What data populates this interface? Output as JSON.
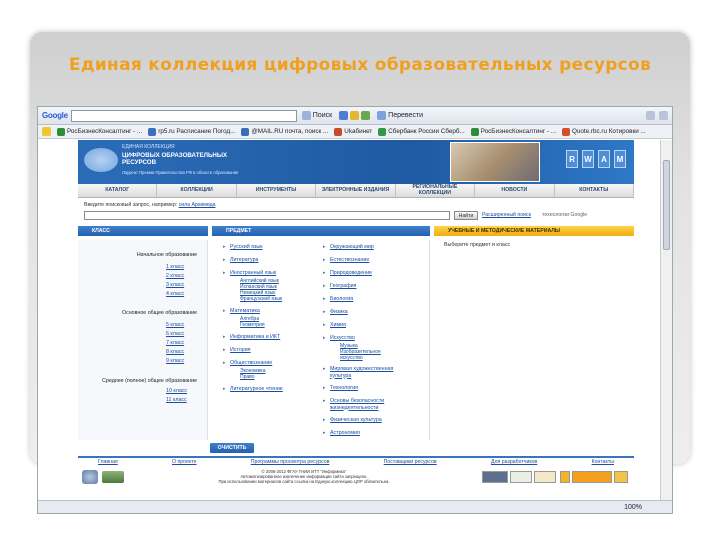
{
  "slide": {
    "title": "Единая коллекция цифровых образовательных ресурсов"
  },
  "browser": {
    "google_logo": "Google",
    "search_btn": "Поиск",
    "translate_btn": "Перевести",
    "bookmarks": [
      {
        "label": "РосБизнесКонсалтинг - ...",
        "color": "#2e8b3a"
      },
      {
        "label": "rp5.ru Расписание Погод...",
        "color": "#3b6fbf"
      },
      {
        "label": "@MAIL.RU почта, поиск ...",
        "color": "#3a6db5"
      },
      {
        "label": "Ukабинет",
        "color": "#c84a2a"
      },
      {
        "label": "Сбербанк России Сберб...",
        "color": "#2f9a45"
      },
      {
        "label": "РосБизнесКонсалтинг - ...",
        "color": "#2e8b3a"
      },
      {
        "label": "Quote.rbc.ru Котировки ...",
        "color": "#d0502a"
      }
    ],
    "zoom": "100%"
  },
  "site": {
    "banner_small": "ЕДИНАЯ КОЛЛЕКЦИЯ",
    "banner_title": "ЦИФРОВЫХ ОБРАЗОВАТЕЛЬНЫХ РЕСУРСОВ",
    "banner_caption": "Лауреат Премии Правительства РФ в области образования",
    "icons": [
      "R",
      "W",
      "A",
      "M"
    ],
    "nav": [
      "КАТАЛОГ",
      "КОЛЛЕКЦИИ",
      "ИНСТРУМЕНТЫ",
      "ЭЛЕКТРОННЫЕ ИЗДАНИЯ",
      "РЕГИОНАЛЬНЫЕ КОЛЛЕКЦИИ",
      "НОВОСТИ",
      "КОНТАКТЫ"
    ],
    "search_hint": "Введите поисковый запрос, например:",
    "search_example": "сила Архимеда",
    "find_btn": "Найти",
    "advanced": "Расширенный поиск",
    "tech": "технологии Google",
    "col_class": "КЛАСС",
    "col_subject": "ПРЕДМЕТ",
    "col_materials": "УЧЕБНЫЕ И МЕТОДИЧЕСКИЕ МАТЕРИАЛЫ",
    "levels": [
      "Начальное образование",
      "Основное общее образование",
      "Среднее (полное) общее образование"
    ],
    "grades_primary": [
      "1 класс",
      "2 класс",
      "3 класс",
      "4 класс"
    ],
    "grades_basic": [
      "5 класс",
      "6 класс",
      "7 класс",
      "8 класс",
      "9 класс"
    ],
    "grades_senior": [
      "10 класс",
      "11 класс"
    ],
    "subjects_left": {
      "russian": "Русский язык",
      "literature": "Литература",
      "foreign": "Иностранный язык",
      "english": "Английский язык",
      "spanish": "Испанский язык",
      "german": "Немецкий язык",
      "french": "Французский язык",
      "math": "Математика",
      "algebra": "Алгебра",
      "geometry": "Геометрия",
      "informatics": "Информатика и ИКТ",
      "history": "История",
      "social": "Обществознание",
      "economics": "Экономика",
      "law": "Право",
      "reading": "Литературное чтение"
    },
    "subjects_right": {
      "world": "Окружающий мир",
      "science": "Естествознание",
      "nature": "Природоведение",
      "geography": "География",
      "biology": "Биология",
      "physics": "Физика",
      "chemistry": "Химия",
      "art": "Искусство",
      "music": "Музыка",
      "fineart": "Изобразительное искусство",
      "worldculture": "Мировая художественная культура",
      "technology": "Технология",
      "safety": "Основы безопасности жизнедеятельности",
      "pe": "Физическая культура",
      "astronomy": "Астрономия"
    },
    "materials_hint": "Выберите предмет и класс",
    "clear_btn": "ОЧИСТИТЬ",
    "footer_links": [
      "Главная",
      "О проекте",
      "Программы просмотра ресурсов",
      "Поставщики ресурсов",
      "Для разработчиков",
      "Контакты"
    ],
    "copyright": "© 2006-2012 ФГАУ ГНИИ ИТТ \"Информика\"",
    "copy2": "Автоматизированное извлечение информации сайта запрещено.",
    "copy3": "При использовании материалов сайта ссылка на Единую коллекцию ЦОР обязательна."
  }
}
